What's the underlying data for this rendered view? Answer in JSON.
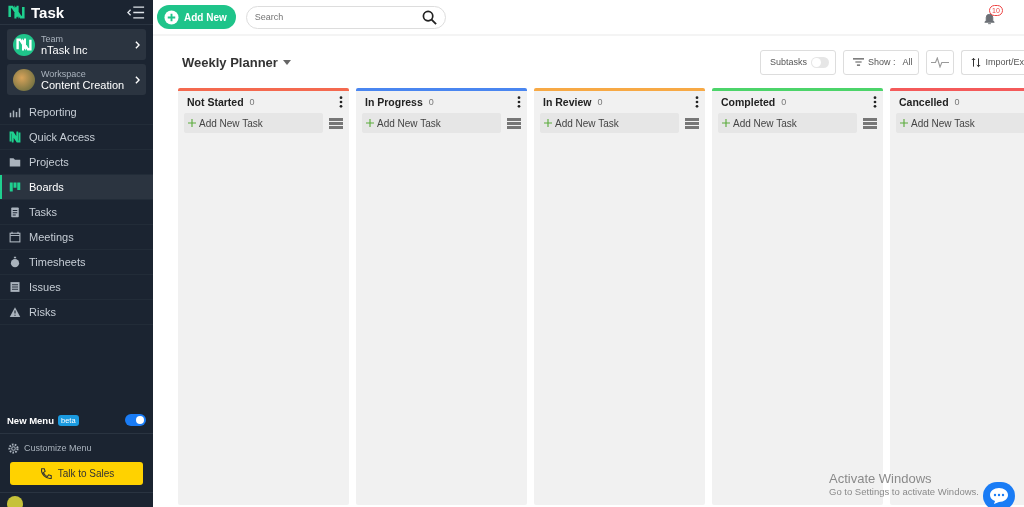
{
  "sidebar": {
    "brand": "Task",
    "team": {
      "caption": "Team",
      "name": "nTask Inc"
    },
    "workspace": {
      "caption": "Workspace",
      "name": "Content Creation"
    },
    "items": [
      {
        "label": "Reporting",
        "selected": false
      },
      {
        "label": "Quick Access",
        "selected": false
      },
      {
        "label": "Projects",
        "selected": false
      },
      {
        "label": "Boards",
        "selected": true
      },
      {
        "label": "Tasks",
        "selected": false
      },
      {
        "label": "Meetings",
        "selected": false
      },
      {
        "label": "Timesheets",
        "selected": false
      },
      {
        "label": "Issues",
        "selected": false
      },
      {
        "label": "Risks",
        "selected": false
      }
    ],
    "new_menu": {
      "label": "New Menu",
      "badge": "beta",
      "on": true
    },
    "customize": "Customize Menu",
    "talk_button": "Talk to Sales"
  },
  "topbar": {
    "add_button": "Add New",
    "search": {
      "placeholder": "Search"
    },
    "notifications": "10"
  },
  "planner": {
    "title": "Weekly Planner",
    "subtasks": {
      "label": "Subtasks",
      "on": false
    },
    "show": {
      "label": "Show :",
      "value": "All"
    },
    "import": "Import/Ex"
  },
  "columns": [
    {
      "name": "Not Started",
      "count": "0",
      "color": "#f4694f",
      "add": "Add New Task"
    },
    {
      "name": "In Progress",
      "count": "0",
      "color": "#4a86f0",
      "add": "Add New Task"
    },
    {
      "name": "In Review",
      "count": "0",
      "color": "#f7a945",
      "add": "Add New Task"
    },
    {
      "name": "Completed",
      "count": "0",
      "color": "#4cd46a",
      "add": "Add New Task"
    },
    {
      "name": "Cancelled",
      "count": "0",
      "color": "#f45a5a",
      "add": "Add New Task"
    }
  ],
  "overlay": {
    "title": "Activate Windows",
    "subtitle": "Go to Settings to activate Windows."
  }
}
